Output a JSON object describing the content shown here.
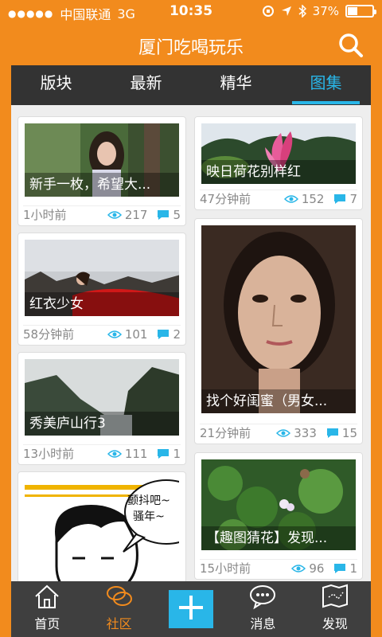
{
  "status": {
    "carrier": "中国联通",
    "network": "3G",
    "time": "10:35",
    "battery": "37%",
    "battery_fraction": 0.37
  },
  "header": {
    "title": "厦门吃喝玩乐",
    "search_icon": "search-icon"
  },
  "tabs": [
    {
      "label": "版块"
    },
    {
      "label": "最新"
    },
    {
      "label": "精华"
    },
    {
      "label": "图集",
      "active": true
    }
  ],
  "posts": [
    {
      "caption": "新手一枚，希望大...",
      "time": "1小时前",
      "views": "217",
      "comments": "5"
    },
    {
      "caption": "红衣少女",
      "time": "58分钟前",
      "views": "101",
      "comments": "2"
    },
    {
      "caption": "秀美庐山行3",
      "time": "13小时前",
      "views": "111",
      "comments": "1"
    },
    {
      "bubble": "颤抖吧~骚年~"
    },
    {
      "caption": "映日荷花别样红",
      "time": "47分钟前",
      "views": "152",
      "comments": "7"
    },
    {
      "caption": "找个好闺蜜（男女...",
      "time": "21分钟前",
      "views": "333",
      "comments": "15"
    },
    {
      "caption": "【趣图猜花】发现...",
      "time": "15小时前",
      "views": "96",
      "comments": "1"
    }
  ],
  "nav": [
    {
      "label": "首页",
      "icon": "home-icon"
    },
    {
      "label": "社区",
      "icon": "chat-bubbles-icon",
      "active": true
    },
    {
      "label": "",
      "icon": "plus-icon"
    },
    {
      "label": "消息",
      "icon": "message-icon"
    },
    {
      "label": "发现",
      "icon": "map-icon"
    }
  ],
  "colors": {
    "brand": "#f28b1d",
    "accent": "#29b6e8",
    "dark": "#333333"
  }
}
